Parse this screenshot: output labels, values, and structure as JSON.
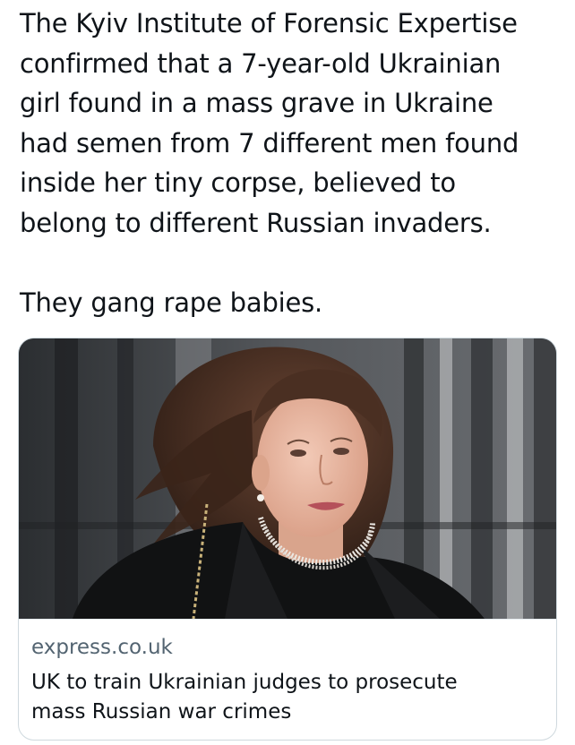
{
  "post": {
    "text": "The Kyiv Institute of Forensic Expertise\nconfirmed that a 7-year-old Ukrainian\ngirl found in a mass grave in Ukraine\nhad semen from 7 different men found\ninside her tiny corpse, believed to\nbelong to different Russian invaders.\n\nThey gang rape babies."
  },
  "link_card": {
    "image_icon": "photo-of-woman-icon",
    "domain": "express.co.uk",
    "title": "UK to train Ukrainian judges to prosecute\nmass Russian war crimes"
  }
}
